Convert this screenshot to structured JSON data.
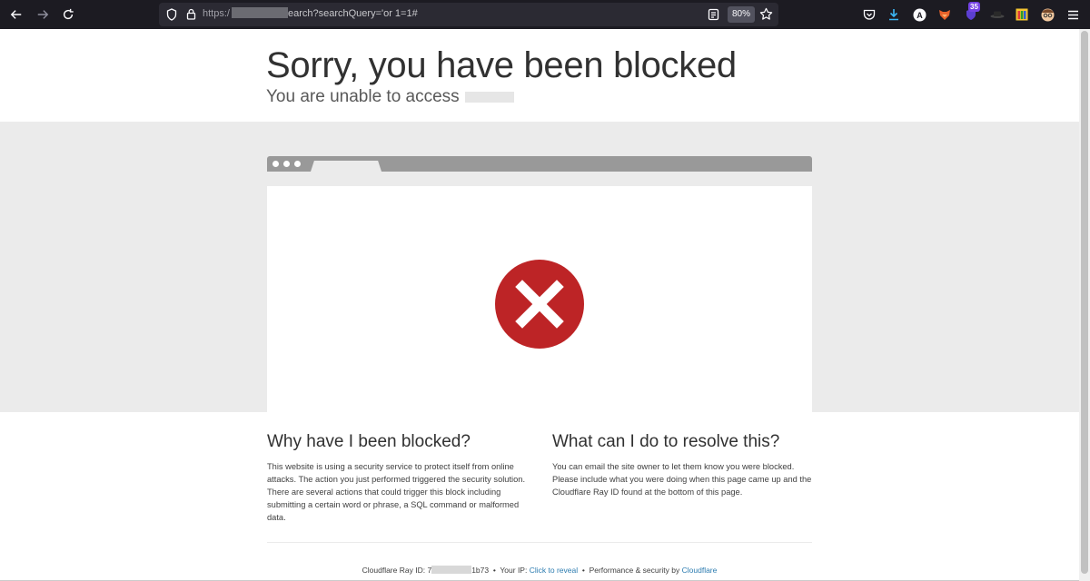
{
  "browser": {
    "url": {
      "protocol": "https:/",
      "path": "earch?searchQuery='or 1=1#"
    },
    "zoom": "80%",
    "extension_badge": "35",
    "account_initial": "A",
    "colors": {
      "toolbar": "#1c1b22",
      "urlbar": "#2b2a33",
      "download": "#3bb6f5"
    }
  },
  "page": {
    "title": "Sorry, you have been blocked",
    "subtitle": "You are unable to access",
    "left": {
      "heading": "Why have I been blocked?",
      "body": "This website is using a security service to protect itself from online attacks. The action you just performed triggered the security solution. There are several actions that could trigger this block including submitting a certain word or phrase, a SQL command or malformed data."
    },
    "right": {
      "heading": "What can I do to resolve this?",
      "body": "You can email the site owner to let them know you were blocked. Please include what you were doing when this page came up and the Cloudflare Ray ID found at the bottom of this page."
    },
    "footer": {
      "ray_label": "Cloudflare Ray ID:",
      "ray_prefix": "7",
      "ray_suffix": "1b73",
      "ip_label": "Your IP:",
      "ip_link": "Click to reveal",
      "perf_label": "Performance & security by",
      "perf_link": "Cloudflare",
      "separator": "•"
    },
    "colors": {
      "error_red": "#bd2426",
      "link": "#2c7cb0",
      "band": "#ebebeb"
    }
  }
}
